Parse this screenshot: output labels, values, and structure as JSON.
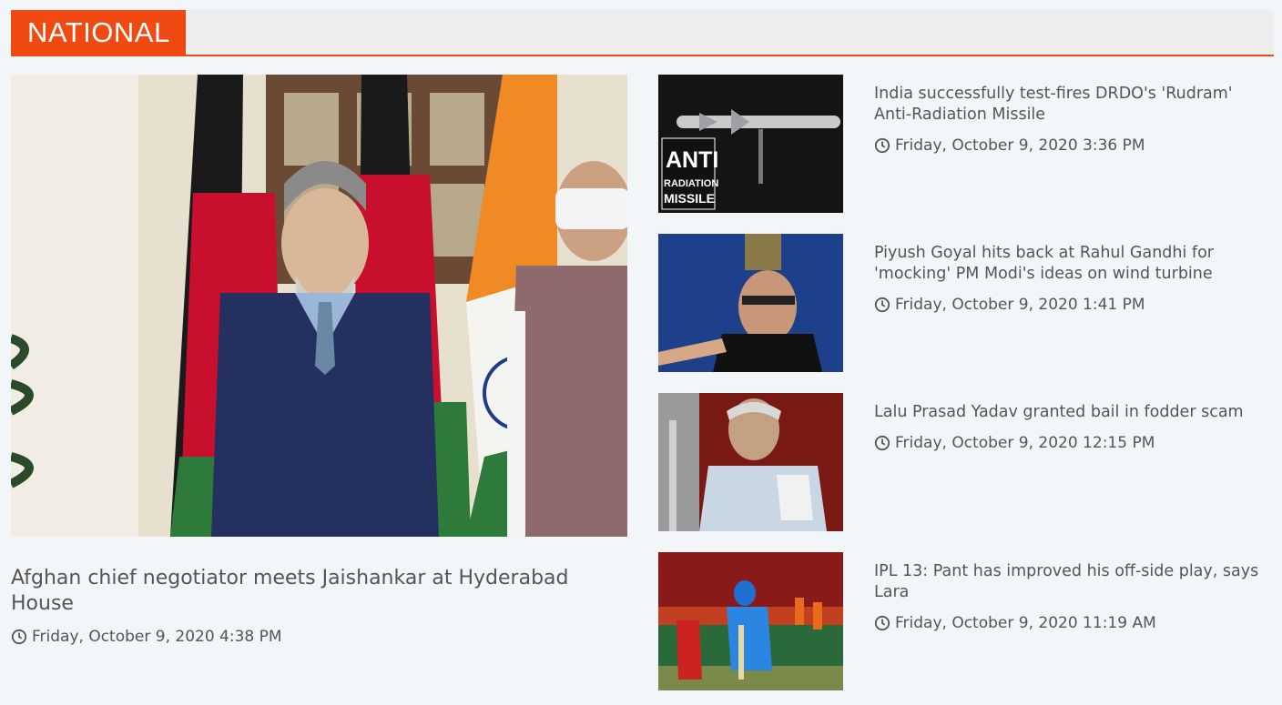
{
  "section": {
    "title": "NATIONAL"
  },
  "lead": {
    "title": "Afghan chief negotiator meets Jaishankar at Hyderabad House",
    "date": "Friday, October 9, 2020 4:38 PM"
  },
  "side": [
    {
      "title": "India successfully test-fires DRDO's 'Rudram' Anti-Radiation Missile",
      "date": "Friday, October 9, 2020 3:36 PM",
      "thumb_text": [
        "ANTI",
        "RADIATION",
        "MISSILE"
      ]
    },
    {
      "title": "Piyush Goyal hits back at Rahul Gandhi for 'mocking' PM Modi's ideas on wind turbine",
      "date": "Friday, October 9, 2020 1:41 PM"
    },
    {
      "title": "Lalu Prasad Yadav granted bail in fodder scam",
      "date": "Friday, October 9, 2020 12:15 PM"
    },
    {
      "title": "IPL 13: Pant has improved his off-side play, says Lara",
      "date": "Friday, October 9, 2020 11:19 AM"
    }
  ],
  "colors": {
    "accent": "#f04a12",
    "background": "#f3f6f9",
    "text": "#555555"
  },
  "icons": {
    "date": "clock-icon"
  }
}
